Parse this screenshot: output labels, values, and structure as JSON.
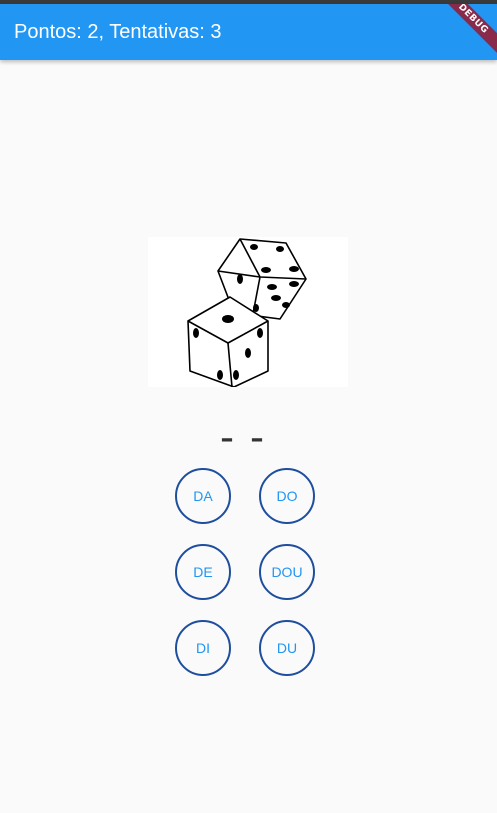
{
  "appbar": {
    "title": "Pontos: 2, Tentativas: 3",
    "debug_banner": "DEBUG",
    "color": "#2196f3"
  },
  "image": {
    "icon": "dice-icon"
  },
  "word": {
    "blanks": "– –"
  },
  "syllables": {
    "da": "DA",
    "do": "DO",
    "de": "DE",
    "dou": "DOU",
    "di": "DI",
    "du": "DU"
  }
}
